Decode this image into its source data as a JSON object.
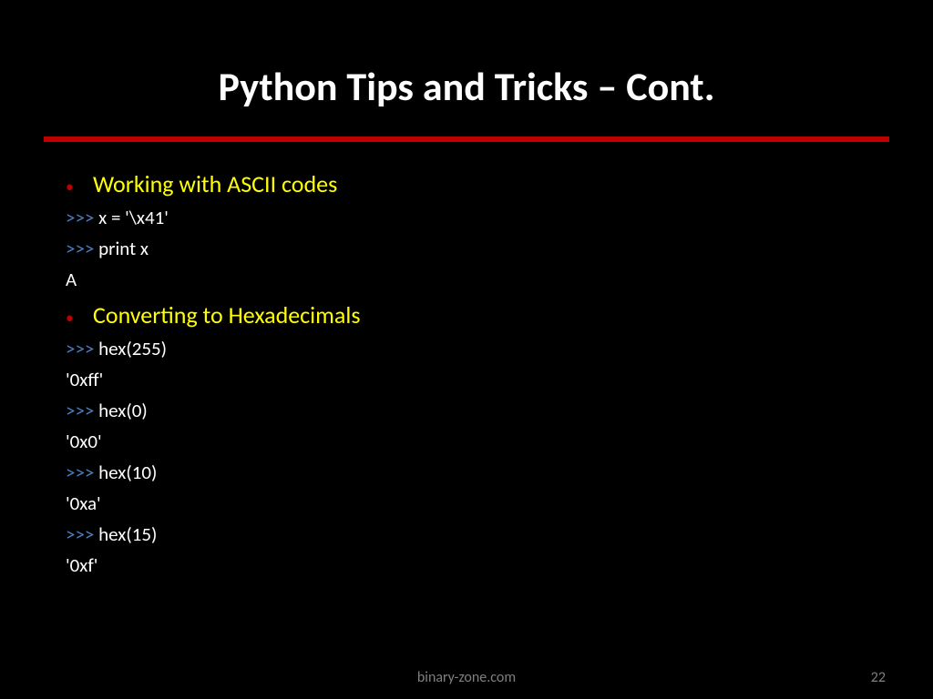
{
  "title": "Python Tips and Tricks – Cont.",
  "sections": [
    {
      "heading": "Working with ASCII codes",
      "lines": [
        {
          "prompt": ">>> ",
          "code": "x = '\\x41'"
        },
        {
          "prompt": ">>> ",
          "code": "print x"
        },
        {
          "prompt": "",
          "code": "A"
        }
      ]
    },
    {
      "heading": "Converting to Hexadecimals",
      "lines": [
        {
          "prompt": ">>> ",
          "code": "hex(255)"
        },
        {
          "prompt": "",
          "code": "'0xff'"
        },
        {
          "prompt": ">>> ",
          "code": "hex(0)"
        },
        {
          "prompt": "",
          "code": "'0x0'"
        },
        {
          "prompt": ">>> ",
          "code": "hex(10)"
        },
        {
          "prompt": "",
          "code": "'0xa'"
        },
        {
          "prompt": ">>> ",
          "code": "hex(15)"
        },
        {
          "prompt": "",
          "code": "'0xf'"
        }
      ]
    }
  ],
  "footer": {
    "center": "binary-zone.com",
    "page": "22"
  }
}
